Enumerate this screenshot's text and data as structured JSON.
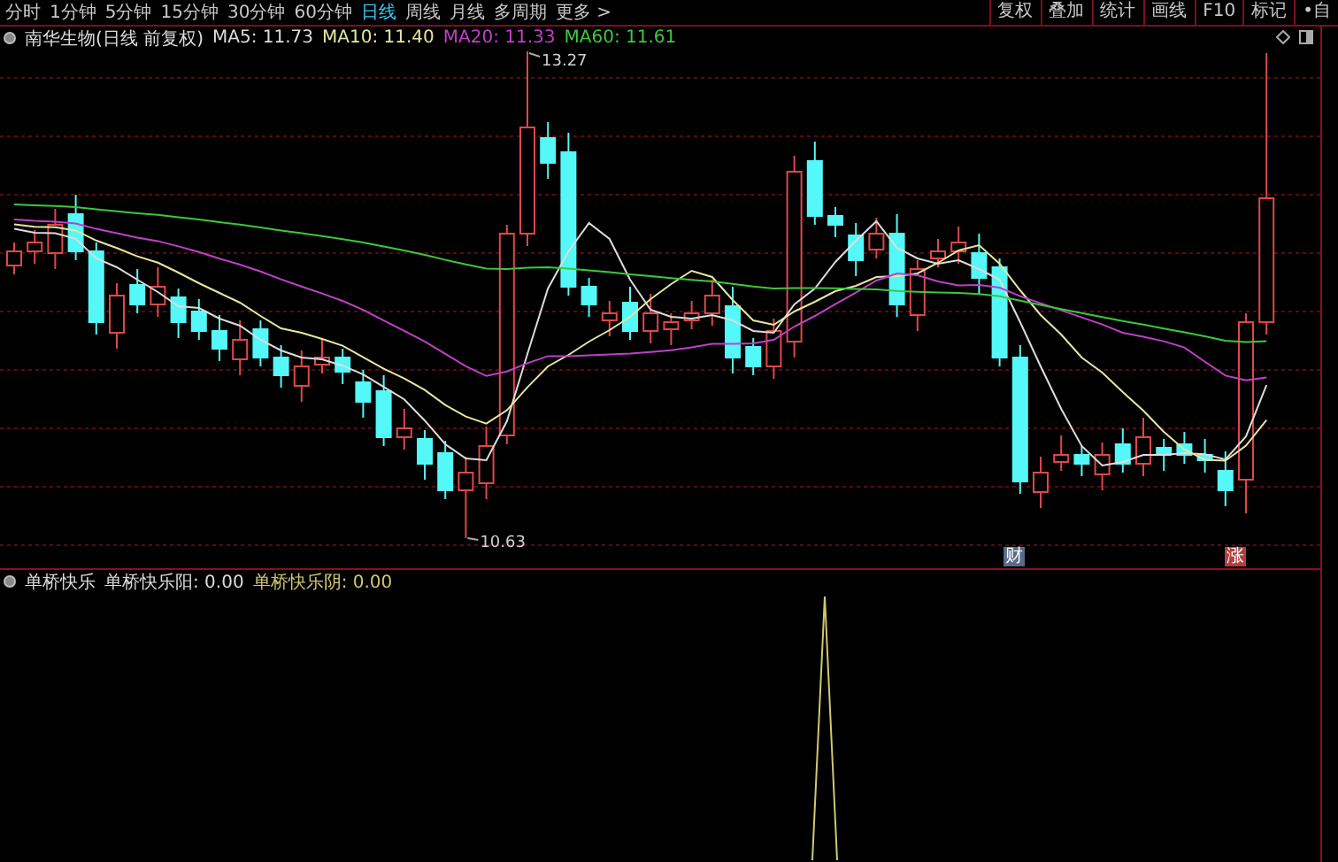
{
  "toolbar": {
    "periods": [
      {
        "label": "分时",
        "selected": false
      },
      {
        "label": "1分钟",
        "selected": false
      },
      {
        "label": "5分钟",
        "selected": false
      },
      {
        "label": "15分钟",
        "selected": false
      },
      {
        "label": "30分钟",
        "selected": false
      },
      {
        "label": "60分钟",
        "selected": false
      },
      {
        "label": "日线",
        "selected": true
      },
      {
        "label": "周线",
        "selected": false
      },
      {
        "label": "月线",
        "selected": false
      },
      {
        "label": "多周期",
        "selected": false
      },
      {
        "label": "更多 >",
        "selected": false
      }
    ],
    "buttons": [
      "复权",
      "叠加",
      "统计",
      "画线",
      "F10",
      "标记",
      "•自"
    ]
  },
  "main_chart": {
    "title": "南华生物(日线 前复权)",
    "moving_averages": [
      {
        "label": "MA5: 11.73",
        "color": "#dcdcdc"
      },
      {
        "label": "MA10: 11.40",
        "color": "#e6e6a0"
      },
      {
        "label": "MA20: 11.33",
        "color": "#c040c8"
      },
      {
        "label": "MA60: 11.61",
        "color": "#3cc83c"
      }
    ],
    "high_label": "13.27",
    "low_label": "10.63",
    "markers": [
      {
        "text": "财",
        "kind": "finance"
      },
      {
        "text": "涨",
        "kind": "limit"
      }
    ]
  },
  "sub_chart": {
    "name": "单桥快乐",
    "values": [
      {
        "label": "单桥快乐阳: 0.00",
        "color": "#dcdcdc"
      },
      {
        "label": "单桥快乐阴: 0.00",
        "color": "#d0c870"
      }
    ]
  }
}
